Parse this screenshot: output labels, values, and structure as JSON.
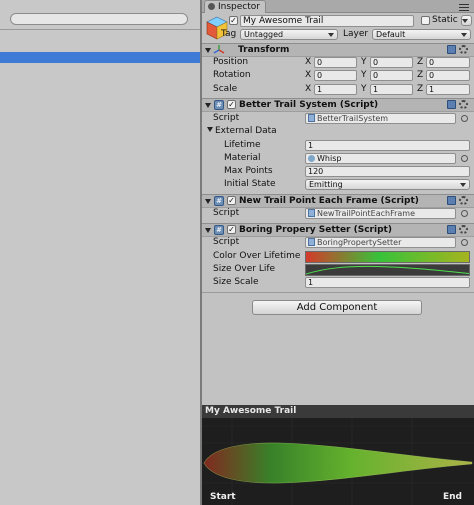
{
  "inspector": {
    "tab_label": "Inspector",
    "object": {
      "name": "My Awesome Trail",
      "static_label": "Static",
      "tag_label": "Tag",
      "tag_value": "Untagged",
      "layer_label": "Layer",
      "layer_value": "Default"
    },
    "transform": {
      "title": "Transform",
      "rows": [
        {
          "label": "Position",
          "x": "0",
          "y": "0",
          "z": "0"
        },
        {
          "label": "Rotation",
          "x": "0",
          "y": "0",
          "z": "0"
        },
        {
          "label": "Scale",
          "x": "1",
          "y": "1",
          "z": "1"
        }
      ],
      "axis_x": "X",
      "axis_y": "Y",
      "axis_z": "Z"
    },
    "better_trail": {
      "title": "Better Trail System (Script)",
      "script_label": "Script",
      "script_value": "BetterTrailSystem",
      "external_label": "External Data",
      "lifetime_label": "Lifetime",
      "lifetime_value": "1",
      "material_label": "Material",
      "material_value": "Whisp",
      "maxpoints_label": "Max Points",
      "maxpoints_value": "120",
      "initstate_label": "Initial State",
      "initstate_value": "Emitting"
    },
    "new_trail_point": {
      "title": "New Trail Point Each Frame (Script)",
      "script_label": "Script",
      "script_value": "NewTrailPointEachFrame"
    },
    "boring_setter": {
      "title": "Boring Propery Setter (Script)",
      "script_label": "Script",
      "script_value": "BoringPropertySetter",
      "color_label": "Color Over Lifetime",
      "size_label": "Size Over Life",
      "scale_label": "Size Scale",
      "scale_value": "1"
    },
    "add_component_label": "Add Component"
  },
  "preview": {
    "title": "My Awesome Trail",
    "start_label": "Start",
    "end_label": "End"
  },
  "colors": {
    "selection_blue": "#3d7bd7",
    "gradient_start": "#d43a2a",
    "gradient_mid": "#37c23a",
    "gradient_end": "#a6b41f",
    "curve_green": "#4fe04f"
  }
}
